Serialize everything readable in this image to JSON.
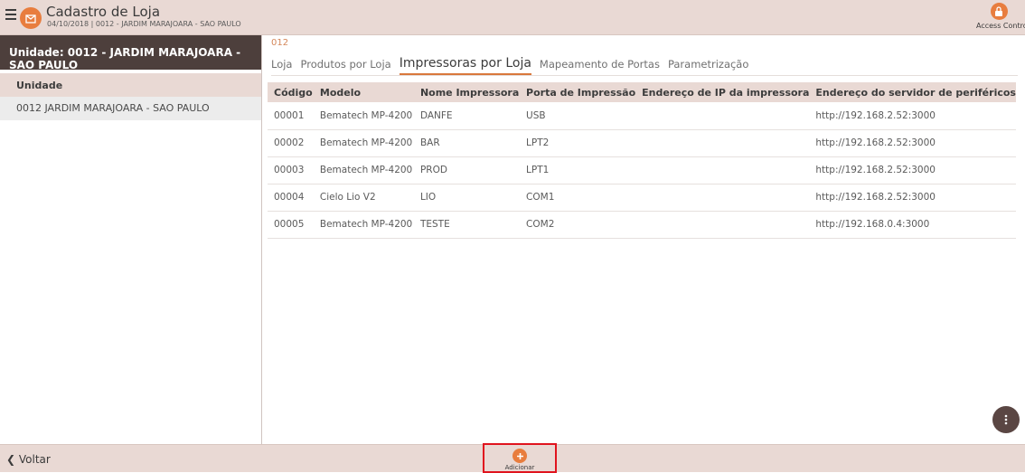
{
  "header": {
    "title": "Cadastro de Loja",
    "subtitle": "04/10/2018 | 0012 - JARDIM MARAJOARA - SAO PAULO",
    "access_label": "Access Control",
    "menu_icon": "hamburger-menu-icon",
    "logo_icon": "store-logo-icon",
    "access_icon": "lock-icon",
    "accent_color": "#e87d3e"
  },
  "sidebar": {
    "unit_header": "Unidade: 0012 - JARDIM MARAJOARA - SAO PAULO",
    "column_header": "Unidade",
    "items": [
      {
        "label": "0012 JARDIM MARAJOARA - SAO PAULO"
      }
    ]
  },
  "main": {
    "store_code": "012",
    "tabs": [
      {
        "label": "Loja",
        "active": false
      },
      {
        "label": "Produtos por Loja",
        "active": false
      },
      {
        "label": "Impressoras por Loja",
        "active": true
      },
      {
        "label": "Mapeamento de Portas",
        "active": false
      },
      {
        "label": "Parametrização",
        "active": false
      }
    ],
    "table": {
      "columns": [
        "Código",
        "Modelo",
        "Nome Impressora",
        "Porta de Impressão",
        "Endereço de IP da impressora",
        "Endereço do servidor de periféricos"
      ],
      "rows": [
        [
          "00001",
          "Bematech MP-4200",
          "DANFE",
          "USB",
          "",
          "http://192.168.2.52:3000"
        ],
        [
          "00002",
          "Bematech MP-4200",
          "BAR",
          "LPT2",
          "",
          "http://192.168.2.52:3000"
        ],
        [
          "00003",
          "Bematech MP-4200",
          "PROD",
          "LPT1",
          "",
          "http://192.168.2.52:3000"
        ],
        [
          "00004",
          "Cielo Lio V2",
          "LIO",
          "COM1",
          "",
          "http://192.168.2.52:3000"
        ],
        [
          "00005",
          "Bematech MP-4200",
          "TESTE",
          "COM2",
          "",
          "http://192.168.0.4:3000"
        ]
      ]
    },
    "more_icon": "more-vertical-icon"
  },
  "footer": {
    "back_label": "Voltar",
    "add_label": "Adicionar",
    "add_icon": "plus-circle-icon"
  }
}
